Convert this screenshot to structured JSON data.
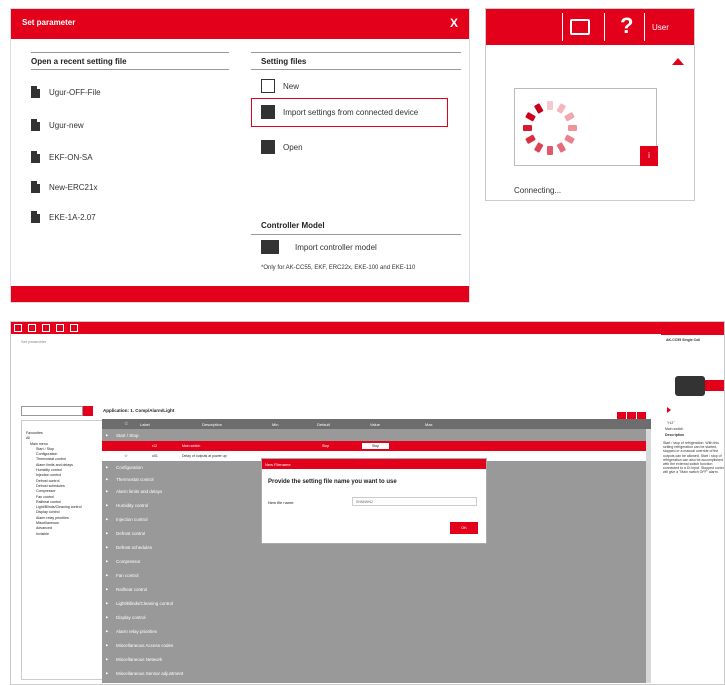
{
  "set_parameter": {
    "title": "Set parameter",
    "close": "X",
    "recent_title": "Open a recent setting file",
    "recent_files": [
      "Ugur-OFF-File",
      "Ugur-new",
      "EKF-ON-SA",
      "New-ERC21x",
      "EKE-1A-2.07"
    ],
    "setting_files_title": "Setting files",
    "new_label": "New",
    "import_label": "Import settings from connected device",
    "open_label": "Open",
    "controller_title": "Controller Model",
    "import_model_label": "Import controller model",
    "note": "*Only for AK-CC55, EKF, ERC22x, EKE-100 and EKE-110"
  },
  "connecting": {
    "help": "?",
    "user": "User",
    "info": "i",
    "status": "Connecting..."
  },
  "app": {
    "breadcrumb": "Set parameter",
    "app_title": "Application: 1. Comp/Alarm/Light",
    "columns": [
      "Label",
      "Description",
      "Min",
      "Default",
      "Value",
      "Max"
    ],
    "tree": [
      "Favourites",
      "All",
      "Main menu",
      "Start / Stop",
      "Configuration",
      "Thermostat control",
      "Alarm limits and delays",
      "Humidity control",
      "Injection control",
      "Defrost control",
      "Defrost schedules",
      "Compressor",
      "Fan control",
      "Railheat control",
      "Light/Blinds/Cleaning control",
      "Display control",
      "Alarm relay priorities",
      "Miscellaneous",
      "Advanced",
      "Invisible"
    ],
    "groups": [
      "Start / Stop",
      "Configuration",
      "Thermostat control",
      "Alarm limits and delays",
      "Humidity control",
      "Injection control",
      "Defrost control",
      "Defrost schedules",
      "Compressor",
      "Fan control",
      "Railheat control",
      "Light/Blinds/Cleaning control",
      "Display control",
      "Alarm relay priorities",
      "Miscellaneous Access codes",
      "Miscellaneous Network",
      "Miscellaneous Sensor adjustment"
    ],
    "row1": {
      "label": "r12",
      "desc": "Main switch",
      "default": "Stop",
      "value": "Stop"
    },
    "row2": {
      "label": "o01",
      "desc": "Delay of outputs at power up"
    },
    "modal": {
      "header": "New Filename",
      "question": "Provide the setting file name you want to use",
      "field_label": "New file name:",
      "field_value": "SNNNNN2",
      "ok": "OK"
    },
    "right_panel": {
      "device": "AK-CC55 Single Coil",
      "param": "\"r12\"",
      "param_name": "Main switch",
      "desc_title": "Description",
      "desc": "Start / stop of refrigeration. With this setting refrigeration can be started, stopped or a manual override of the outputs can be allowed. Start / stop of refrigeration can also be accomplished with the external switch function connected to a DI input. Stopped control will give a \"Main switch OFF\" alarm."
    }
  }
}
